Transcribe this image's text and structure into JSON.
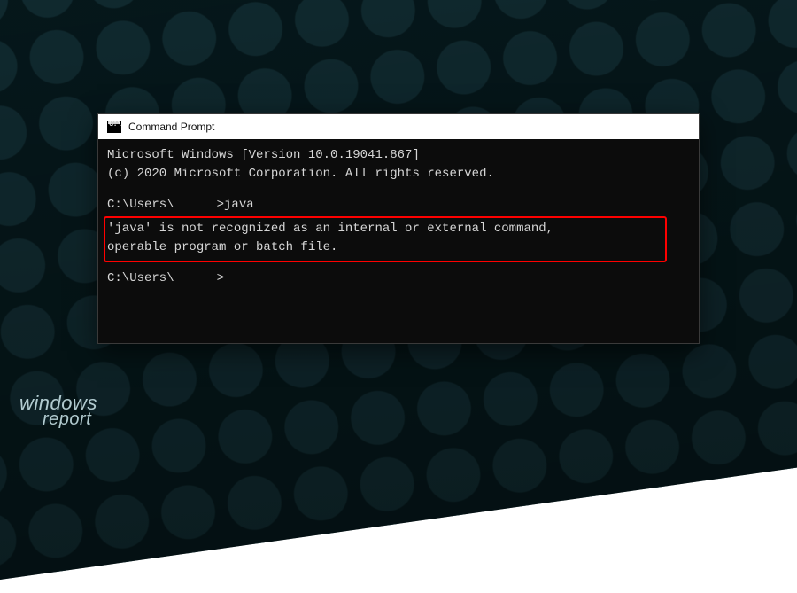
{
  "window": {
    "title": "Command Prompt"
  },
  "terminal": {
    "banner_line1": "Microsoft Windows [Version 10.0.19041.867]",
    "banner_line2": "(c) 2020 Microsoft Corporation. All rights reserved.",
    "prompt1_prefix": "C:\\Users\\",
    "prompt1_suffix": ">",
    "command1": "java",
    "error_line1": "'java' is not recognized as an internal or external command,",
    "error_line2": "operable program or batch file.",
    "prompt2_prefix": "C:\\Users\\",
    "prompt2_suffix": ">"
  },
  "watermark": {
    "line1": "windows",
    "line2": "report"
  }
}
